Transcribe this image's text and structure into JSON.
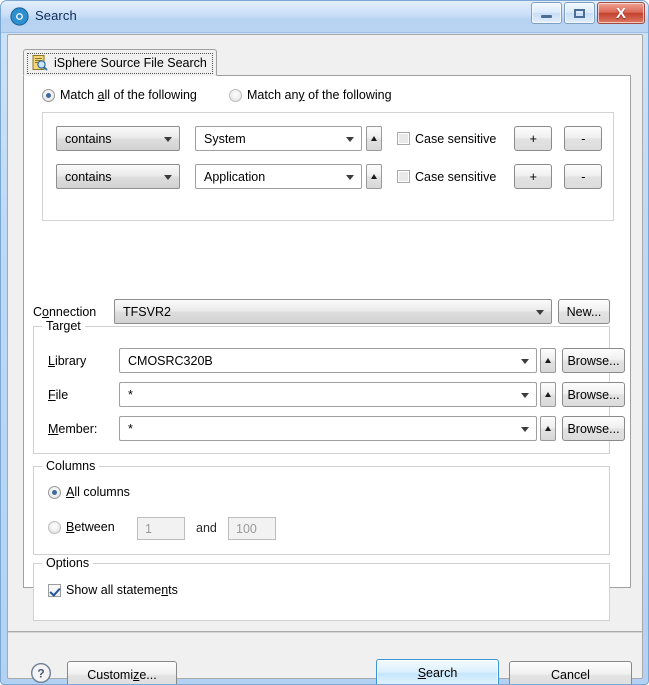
{
  "window": {
    "title": "Search",
    "icon": "isphere-logo-icon",
    "controls": {
      "minimize": "minimize-icon",
      "maximize": "maximize-icon",
      "close": "X"
    }
  },
  "tab": {
    "label": "iSphere Source File Search",
    "icon": "source-file-search-icon"
  },
  "match": {
    "all": {
      "prefix": "Match ",
      "mnemonic": "a",
      "suffix": "ll of the following",
      "selected": true
    },
    "any": {
      "prefix": "Match an",
      "mnemonic": "y",
      "suffix": " of the following",
      "selected": false
    }
  },
  "criteria": [
    {
      "operator": "contains",
      "value": "System",
      "case_sensitive_label": "Case sensitive",
      "case_sensitive": false,
      "add_label": "+",
      "remove_label": "-"
    },
    {
      "operator": "contains",
      "value": "Application",
      "case_sensitive_label": "Case sensitive",
      "case_sensitive": false,
      "add_label": "+",
      "remove_label": "-"
    }
  ],
  "connection": {
    "label_prefix": "C",
    "label_mnemonic": "o",
    "label_suffix": "nnection",
    "value": "TFSVR2",
    "new_button": "New..."
  },
  "target": {
    "title": "Target",
    "rows": [
      {
        "label_prefix": "",
        "label_mnemonic": "L",
        "label_suffix": "ibrary",
        "value": "CMOSRC320B",
        "browse": "Browse..."
      },
      {
        "label_prefix": "",
        "label_mnemonic": "F",
        "label_suffix": "ile",
        "value": "*",
        "browse": "Browse..."
      },
      {
        "label_prefix": "",
        "label_mnemonic": "M",
        "label_suffix": "ember:",
        "value": "*",
        "browse": "Browse..."
      }
    ]
  },
  "columns": {
    "title": "Columns",
    "all": {
      "prefix": "",
      "mnemonic": "A",
      "suffix": "ll columns",
      "selected": true
    },
    "between": {
      "prefix": "",
      "mnemonic": "B",
      "suffix": "etween",
      "selected": false
    },
    "from_value": "1",
    "and_label": "and",
    "to_value": "100"
  },
  "options": {
    "title": "Options",
    "show_all": {
      "prefix": "Show all stateme",
      "mnemonic": "n",
      "suffix": "ts",
      "checked": true
    }
  },
  "footer": {
    "help": "help-icon",
    "customize": {
      "prefix": "Customi",
      "mnemonic": "z",
      "suffix": "e..."
    },
    "search": {
      "prefix": "",
      "mnemonic": "S",
      "suffix": "earch"
    },
    "cancel": "Cancel"
  }
}
